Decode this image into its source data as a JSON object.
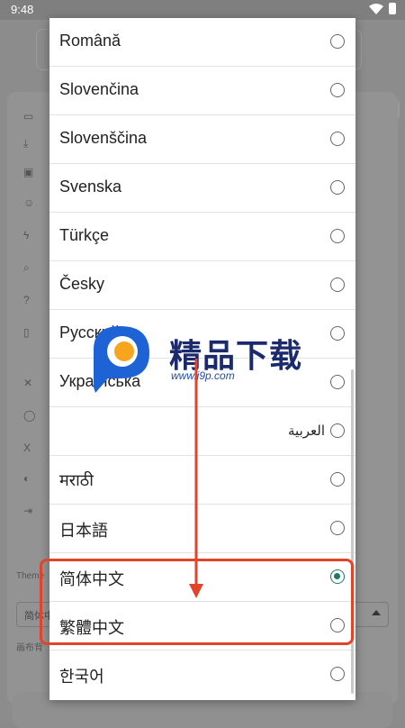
{
  "status_bar": {
    "time": "9:48"
  },
  "background": {
    "theme_label": "Theme",
    "select_value": "简体中",
    "canvas_label": "画布背"
  },
  "languages": [
    {
      "label": "Română",
      "selected": false
    },
    {
      "label": "Slovenčina",
      "selected": false
    },
    {
      "label": "Slovenščina",
      "selected": false
    },
    {
      "label": "Svenska",
      "selected": false
    },
    {
      "label": "Türkçe",
      "selected": false
    },
    {
      "label": "Česky",
      "selected": false
    },
    {
      "label": "Русский",
      "selected": false
    },
    {
      "label": "Українська",
      "selected": false
    },
    {
      "label": "العربية",
      "selected": false,
      "rtl": true
    },
    {
      "label": "मराठी",
      "selected": false
    },
    {
      "label": "日本語",
      "selected": false
    },
    {
      "label": "简体中文",
      "selected": true
    },
    {
      "label": "繁體中文",
      "selected": false
    },
    {
      "label": "한국어",
      "selected": false
    }
  ],
  "watermark": {
    "title": "精品下载",
    "url": "www.j9p.com"
  },
  "colors": {
    "accent": "#1e7a66",
    "annotation": "#e0452c"
  }
}
